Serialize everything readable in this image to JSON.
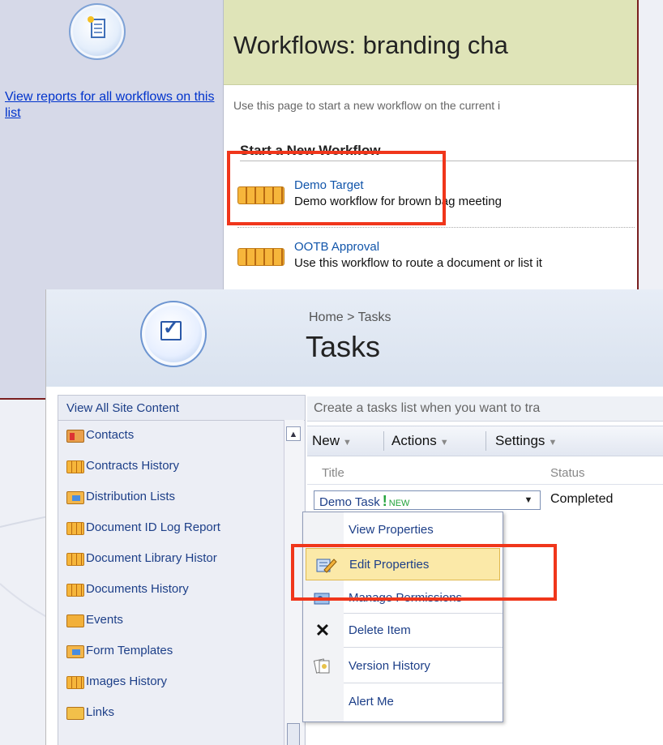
{
  "workflows_page": {
    "title": "Workflows: branding cha",
    "sidebar_link": "View reports for all workflows on this list",
    "description": "Use this page to start a new workflow on the current i",
    "section_heading": "Start a New Workflow",
    "workflows": [
      {
        "name": "Demo Target",
        "description": "Demo workflow for brown bag meeting"
      },
      {
        "name": "OOTB Approval",
        "description": "Use this workflow to route a document or list it"
      }
    ]
  },
  "tasks_page": {
    "breadcrumb": "Home > Tasks",
    "title": "Tasks",
    "nav_header": "View All Site Content",
    "nav_items": [
      {
        "label": "Contacts",
        "icon": "contacts-icon"
      },
      {
        "label": "Contracts History",
        "icon": "list-icon"
      },
      {
        "label": "Distribution Lists",
        "icon": "folder-icon"
      },
      {
        "label": "Document ID Log Report",
        "icon": "list-icon"
      },
      {
        "label": "Document Library Histor",
        "icon": "list-icon"
      },
      {
        "label": "Documents History",
        "icon": "list-icon"
      },
      {
        "label": "Events",
        "icon": "calendar-icon"
      },
      {
        "label": "Form Templates",
        "icon": "folder-icon"
      },
      {
        "label": "Images History",
        "icon": "list-icon"
      },
      {
        "label": "Links",
        "icon": "links-icon"
      }
    ],
    "list_description": "Create a tasks list when you want to tra",
    "toolbar": {
      "new": "New",
      "actions": "Actions",
      "settings": "Settings"
    },
    "columns": {
      "title": "Title",
      "status": "Status"
    },
    "row": {
      "title": "Demo Task",
      "new_flag": "!",
      "new_badge": "NEW",
      "status": "Completed"
    },
    "context_menu": [
      {
        "label": "View Properties",
        "icon": ""
      },
      {
        "label": "Edit Properties",
        "icon": "edit-icon"
      },
      {
        "label": "Manage Permissions",
        "icon": "permissions-icon"
      },
      {
        "label": "Delete Item",
        "icon": "delete-icon"
      },
      {
        "label": "Version History",
        "icon": "version-history-icon"
      },
      {
        "label": "Alert Me",
        "icon": ""
      }
    ]
  },
  "colors": {
    "highlight_box": "#f0361b",
    "menu_highlight": "#fbe9a8",
    "workflow_header": "#dfe4b8"
  }
}
